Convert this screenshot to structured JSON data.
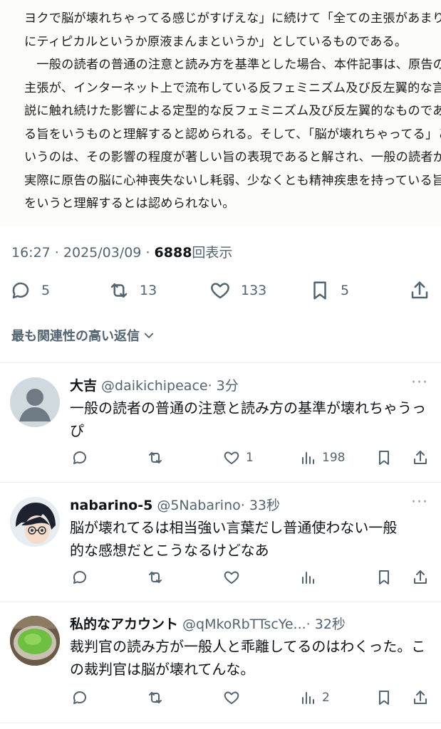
{
  "document": {
    "lines": [
      "ヨクで脳が壊れちゃってる感じがすげえな」に続けて「全ての主張があまり",
      "にティピカルというか原液まんまというか」としているものである。",
      "　一般の読者の普通の注意と読み方を基準とした場合、本件記事は、原告の",
      "主張が、インターネット上で流布している反フェミニズム及び反左翼的な言",
      "説に触れ続けた影響による定型的な反フェミニズム及び反左翼的なものであ",
      "る旨をいうものと理解すると認められる。そして、「脳が壊れちゃってる」と",
      "いうのは、その影響の程度が著しい旨の表現であると解され、一般の読者が、",
      "実際に原告の脳に心神喪失ないし耗弱、少なくとも精神疾患を持っている旨",
      "をいうと理解するとは認められない。"
    ]
  },
  "tweet_meta": {
    "time": "16:27",
    "sep1": " · ",
    "date": "2025/03/09",
    "sep2": " · ",
    "views": "6888",
    "views_label": "回表示"
  },
  "tweet_actions": {
    "replies": "5",
    "retweets": "13",
    "likes": "133",
    "bookmarks": "5"
  },
  "sort_label": "最も関連性の高い返信",
  "replies": [
    {
      "name": "大吉",
      "handle": "@daikichipeace",
      "time": "· 3分",
      "body": "一般の読者の普通の注意と読み方の基準が壊れちゃうっぴ",
      "likes": "1",
      "views": "198"
    },
    {
      "name": "nabarino-5",
      "handle": "@5Nabarino",
      "time": "· 33秒",
      "body": "脳が壊れてるは相当強い言葉だし普通使わない一般的な感想だとこうなるけどなあ",
      "likes": "",
      "views": ""
    },
    {
      "name": "私的なアカウント",
      "handle": "@qMkoRbTTscYe...",
      "time": "· 32秒",
      "body": "裁判官の読み方が一般人と乖離してるのはわくった。この裁判官は脳が壊れてんな。",
      "likes": "",
      "views": "2"
    }
  ],
  "more_label": "···",
  "colors": {
    "text": "#0f1419",
    "secondary": "#536471",
    "divider": "#eff3f4"
  }
}
